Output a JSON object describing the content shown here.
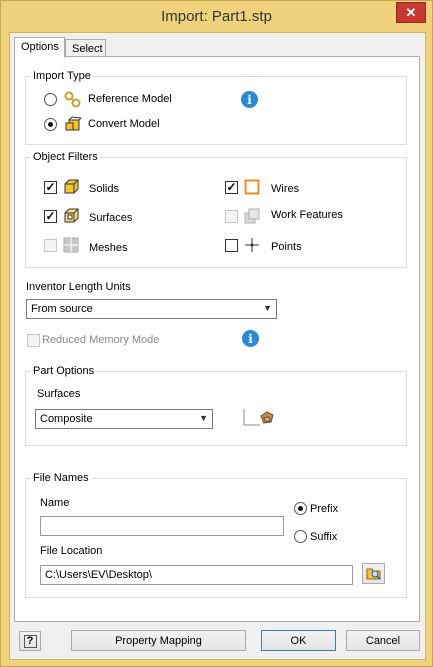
{
  "window": {
    "title": "Import:  Part1.stp",
    "close_glyph": "✕"
  },
  "tabs": [
    {
      "label": "Options"
    },
    {
      "label": "Select"
    }
  ],
  "import_type": {
    "title": "Import Type",
    "reference_model": "Reference Model",
    "convert_model": "Convert Model",
    "selected": "convert_model"
  },
  "object_filters": {
    "title": "Object Filters",
    "solids": {
      "label": "Solids",
      "checked": true
    },
    "surfaces": {
      "label": "Surfaces",
      "checked": true
    },
    "meshes": {
      "label": "Meshes",
      "checked": false,
      "disabled": true
    },
    "wires": {
      "label": "Wires",
      "checked": true
    },
    "work_features": {
      "label": "Work Features",
      "checked": false,
      "disabled": true
    },
    "points": {
      "label": "Points",
      "checked": false
    }
  },
  "units": {
    "label": "Inventor Length Units",
    "value": "From source"
  },
  "reduced_memory": {
    "label": "Reduced Memory Mode",
    "checked": false,
    "disabled": true
  },
  "part_options": {
    "title": "Part Options",
    "surfaces_label": "Surfaces",
    "surfaces_value": "Composite"
  },
  "file_names": {
    "title": "File Names",
    "name_label": "Name",
    "name_value": "",
    "prefix_label": "Prefix",
    "suffix_label": "Suffix",
    "selected": "prefix",
    "location_label": "File Location",
    "location_value": "C:\\Users\\EV\\Desktop\\"
  },
  "footer": {
    "help_glyph": "?",
    "property_mapping": "Property Mapping",
    "ok": "OK",
    "cancel": "Cancel"
  },
  "info_glyph": "i",
  "check_glyph": "✓",
  "dropdown_glyph": "▼",
  "colors": {
    "titlebar": "#f0d27c",
    "close": "#c7392f",
    "info": "#2a8ad8",
    "wire_orange": "#f08c1e"
  }
}
